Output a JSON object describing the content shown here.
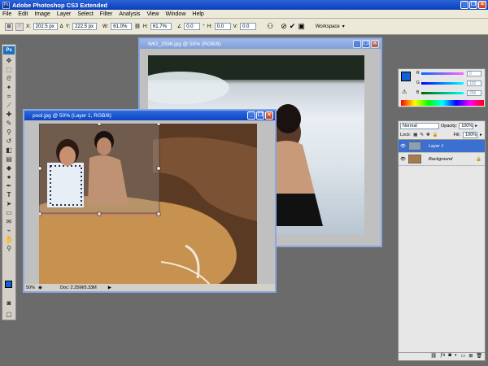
{
  "app": {
    "title": "Adobe Photoshop CS3 Extended",
    "logo_text": "Ps"
  },
  "menu": [
    "File",
    "Edit",
    "Image",
    "Layer",
    "Select",
    "Filter",
    "Analysis",
    "View",
    "Window",
    "Help"
  ],
  "options": {
    "x_label": "X:",
    "x_value": "202.5 px",
    "y_label": "Y:",
    "y_value": "222.5 px",
    "w_label": "W:",
    "w_value": "61.0%",
    "h_label": "H:",
    "h_value": "61.7%",
    "angle_value": "0.0",
    "hskew_label": "H:",
    "hskew_value": "0.0",
    "vskew_label": "V:",
    "vskew_value": "0.0",
    "workspace_label": "Workspace"
  },
  "doc_back": {
    "title": "IMG_2596.jpg @ 50% (RGB/8)"
  },
  "doc_front": {
    "title": "pool.jpg @ 50% (Layer 1, RGB/8)",
    "zoom": "50%",
    "doc_info": "Doc: 2.25M/5.33M"
  },
  "color_panel": {
    "r_label": "R",
    "r_value": "0",
    "g_label": "G",
    "g_value": "102",
    "b_label": "B",
    "b_value": "255",
    "fg_color": "#1060d8"
  },
  "layers_panel": {
    "blend_mode": "Normal",
    "opacity_label": "Opacity:",
    "opacity_value": "100%",
    "lock_label": "Lock:",
    "fill_label": "Fill:",
    "fill_value": "100%",
    "layers": [
      {
        "name": "Layer 1",
        "selected": true
      },
      {
        "name": "Background",
        "selected": false
      }
    ]
  }
}
